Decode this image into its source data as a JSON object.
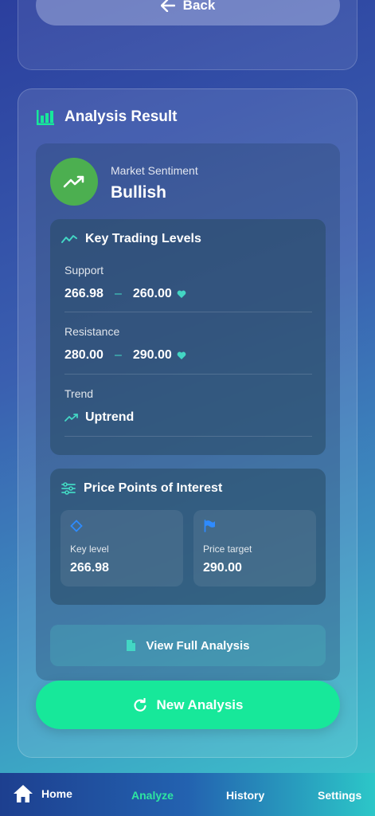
{
  "back_button": {
    "label": "Back"
  },
  "analysis": {
    "title": "Analysis Result",
    "sentiment_label": "Market Sentiment",
    "sentiment_value": "Bullish",
    "key_levels": {
      "title": "Key Trading Levels",
      "support_label": "Support",
      "support_low": "266.98",
      "support_high": "260.00",
      "resistance_label": "Resistance",
      "resistance_low": "280.00",
      "resistance_high": "290.00",
      "trend_label": "Trend",
      "trend_value": "Uptrend"
    },
    "price_points": {
      "title": "Price Points of Interest",
      "items": [
        {
          "label": "Key level",
          "value": "266.98",
          "icon": "diamond-icon"
        },
        {
          "label": "Price target",
          "value": "290.00",
          "icon": "flag-icon"
        }
      ]
    },
    "view_full_label": "View Full Analysis",
    "new_analysis_label": "New Analysis"
  },
  "nav": {
    "items": [
      {
        "label": "Home",
        "icon": "home-icon"
      },
      {
        "label": "Analyze"
      },
      {
        "label": "History"
      },
      {
        "label": "Settings"
      }
    ]
  },
  "colors": {
    "accent_green": "#17e89a",
    "teal": "#43d6c4",
    "sentiment_green": "#4caf50",
    "flag_blue": "#2e8bff"
  }
}
